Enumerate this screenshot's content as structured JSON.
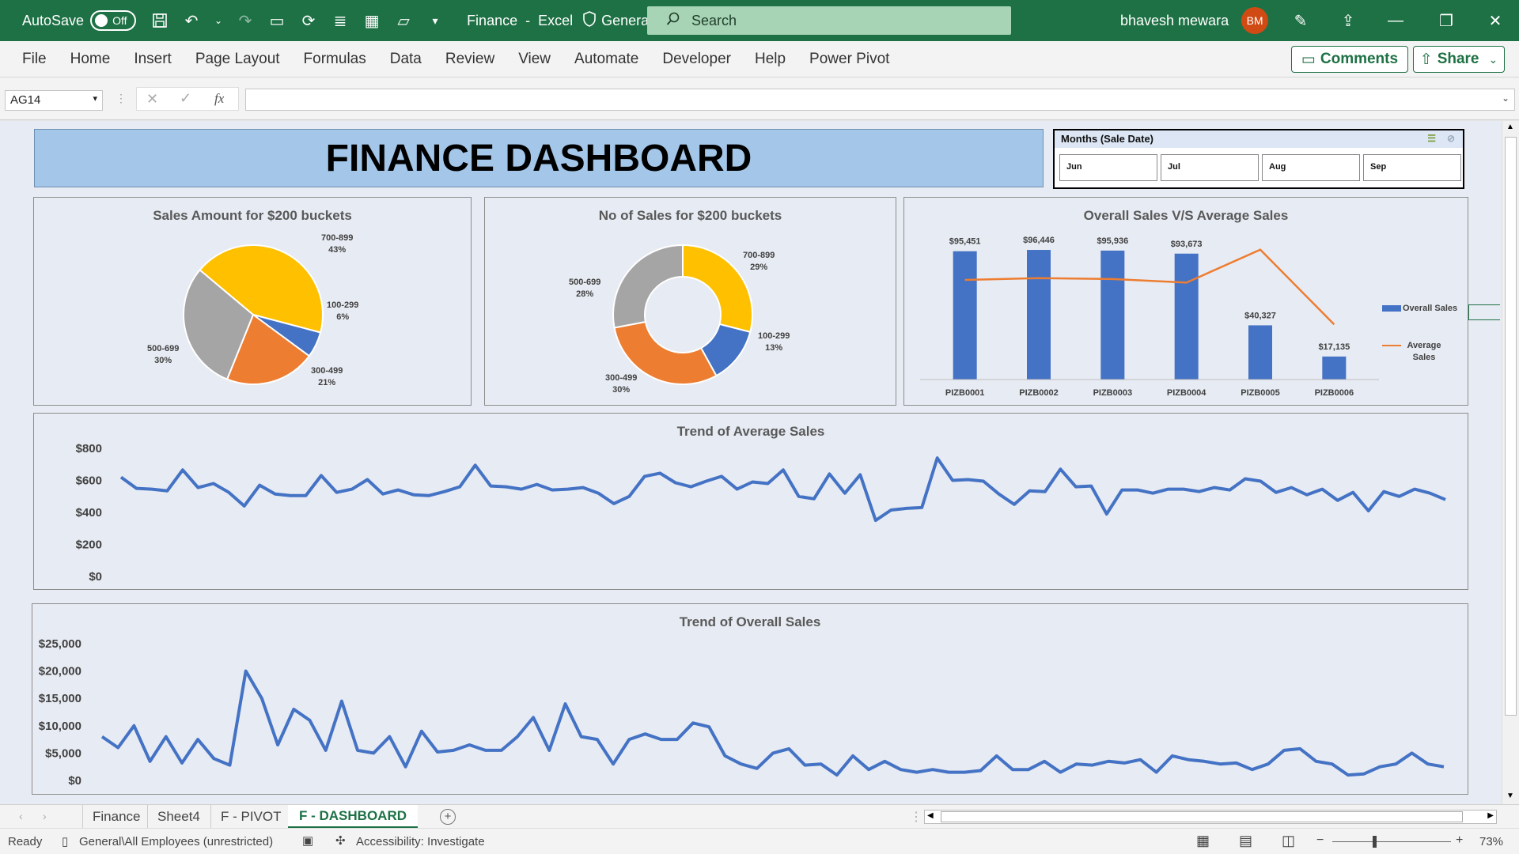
{
  "titlebar": {
    "autosave_label": "AutoSave",
    "autosave_state": "Off",
    "file_name": "Finance",
    "app_name": "Excel",
    "sensitivity": "General",
    "search_placeholder": "Search",
    "user_name": "bhavesh mewara",
    "user_initials": "BM"
  },
  "ribbon": {
    "tabs": [
      "File",
      "Home",
      "Insert",
      "Page Layout",
      "Formulas",
      "Data",
      "Review",
      "View",
      "Automate",
      "Developer",
      "Help",
      "Power Pivot"
    ],
    "comments_label": "Comments",
    "share_label": "Share"
  },
  "formula_bar": {
    "name_box": "AG14",
    "fx_label": "fx",
    "value": ""
  },
  "dashboard": {
    "title": "FINANCE DASHBOARD",
    "slicer": {
      "title": "Months (Sale Date)",
      "items": [
        "Jun",
        "Jul",
        "Aug",
        "Sep"
      ]
    }
  },
  "chart_data": [
    {
      "type": "pie",
      "title": "Sales Amount for $200 buckets",
      "slices": [
        {
          "label": "700-899",
          "pct": "43%",
          "value": 43,
          "color": "#ffc000"
        },
        {
          "label": "100-299",
          "pct": "6%",
          "value": 6,
          "color": "#4472c4"
        },
        {
          "label": "300-499",
          "pct": "21%",
          "value": 21,
          "color": "#ed7d31"
        },
        {
          "label": "500-699",
          "pct": "30%",
          "value": 30,
          "color": "#a5a5a5"
        }
      ]
    },
    {
      "type": "pie",
      "title": "No of Sales for $200 buckets",
      "slices": [
        {
          "label": "700-899",
          "pct": "29%",
          "value": 29,
          "color": "#ffc000"
        },
        {
          "label": "100-299",
          "pct": "13%",
          "value": 13,
          "color": "#4472c4"
        },
        {
          "label": "300-499",
          "pct": "30%",
          "value": 30,
          "color": "#ed7d31"
        },
        {
          "label": "500-699",
          "pct": "28%",
          "value": 28,
          "color": "#a5a5a5"
        }
      ]
    },
    {
      "type": "bar",
      "title": "Overall Sales V/S Average Sales",
      "categories": [
        "PIZB0001",
        "PIZB0002",
        "PIZB0003",
        "PIZB0004",
        "PIZB0005",
        "PIZB0006"
      ],
      "series": [
        {
          "name": "Overall Sales",
          "values": [
            95451,
            96446,
            95936,
            93673,
            40327,
            17135
          ],
          "labels": [
            "$95,451",
            "$96,446",
            "$95,936",
            "$93,673",
            "$40,327",
            "$17,135"
          ],
          "color": "#4472c4"
        },
        {
          "name": "Average Sales",
          "values": [
            560,
            570,
            565,
            545,
            730,
            310
          ],
          "color": "#ed7d31"
        }
      ]
    },
    {
      "type": "line",
      "title": "Trend of Average Sales",
      "ylim": [
        0,
        800
      ],
      "yticks": [
        "$800",
        "$600",
        "$400",
        "$200",
        "$0"
      ],
      "color": "#4472c4",
      "values": [
        620,
        550,
        545,
        535,
        665,
        555,
        580,
        525,
        440,
        570,
        515,
        505,
        505,
        630,
        525,
        545,
        605,
        515,
        540,
        510,
        505,
        530,
        560,
        695,
        565,
        560,
        545,
        575,
        540,
        545,
        555,
        520,
        455,
        500,
        625,
        645,
        585,
        560,
        595,
        625,
        545,
        590,
        580,
        665,
        500,
        485,
        640,
        520,
        635,
        350,
        415,
        425,
        430,
        740,
        600,
        605,
        595,
        515,
        450,
        535,
        530,
        670,
        560,
        565,
        390,
        540,
        540,
        520,
        545,
        545,
        530,
        555,
        540,
        610,
        595,
        525,
        555,
        510,
        545,
        475,
        525,
        410,
        530,
        500,
        545,
        520,
        480
      ],
      "color_name": "blue"
    },
    {
      "type": "line",
      "title": "Trend of Overall Sales",
      "ylim": [
        0,
        25000
      ],
      "yticks": [
        "$25,000",
        "$20,000",
        "$15,000",
        "$10,000",
        "$5,000",
        "$0"
      ],
      "color": "#4472c4",
      "values": [
        8000,
        6000,
        10000,
        3500,
        8000,
        3200,
        7500,
        4000,
        2800,
        20000,
        15000,
        6500,
        13000,
        11000,
        5500,
        14500,
        5500,
        5000,
        8000,
        2500,
        9000,
        5200,
        5500,
        6500,
        5500,
        5500,
        8000,
        11500,
        5500,
        14000,
        8000,
        7500,
        3000,
        7500,
        8500,
        7500,
        7500,
        10500,
        9800,
        4500,
        3000,
        2200,
        5000,
        5800,
        2800,
        3000,
        1000,
        4500,
        2000,
        3500,
        2000,
        1500,
        2000,
        1500,
        1500,
        1800,
        4500,
        2000,
        2000,
        3500,
        1500,
        3000,
        2800,
        3500,
        3200,
        3800,
        1500,
        4500,
        3800,
        3500,
        3000,
        3200,
        2000,
        3000,
        5500,
        5800,
        3500,
        3000,
        1000,
        1200,
        2500,
        3000,
        5000,
        3000,
        2500
      ]
    }
  ],
  "sheet_tabs": [
    "Finance",
    "Sheet4",
    "F - PIVOT",
    "F - DASHBOARD"
  ],
  "status": {
    "ready": "Ready",
    "sensitivity": "General\\All Employees (unrestricted)",
    "accessibility": "Accessibility: Investigate",
    "zoom": "73%"
  }
}
